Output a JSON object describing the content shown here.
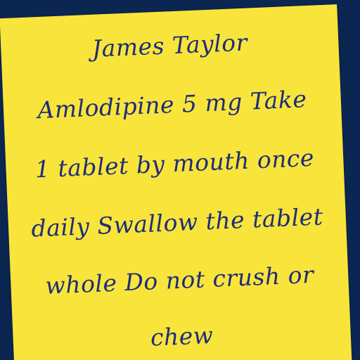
{
  "note": {
    "lines": [
      "James Taylor",
      "Amlodipine 5 mg Take",
      "1 tablet by mouth once",
      "daily Swallow the tablet",
      "whole Do not crush or",
      "chew"
    ]
  },
  "colors": {
    "background": "#0b2650",
    "paper": "#f9e43b",
    "ink": "#1c2d7a"
  }
}
